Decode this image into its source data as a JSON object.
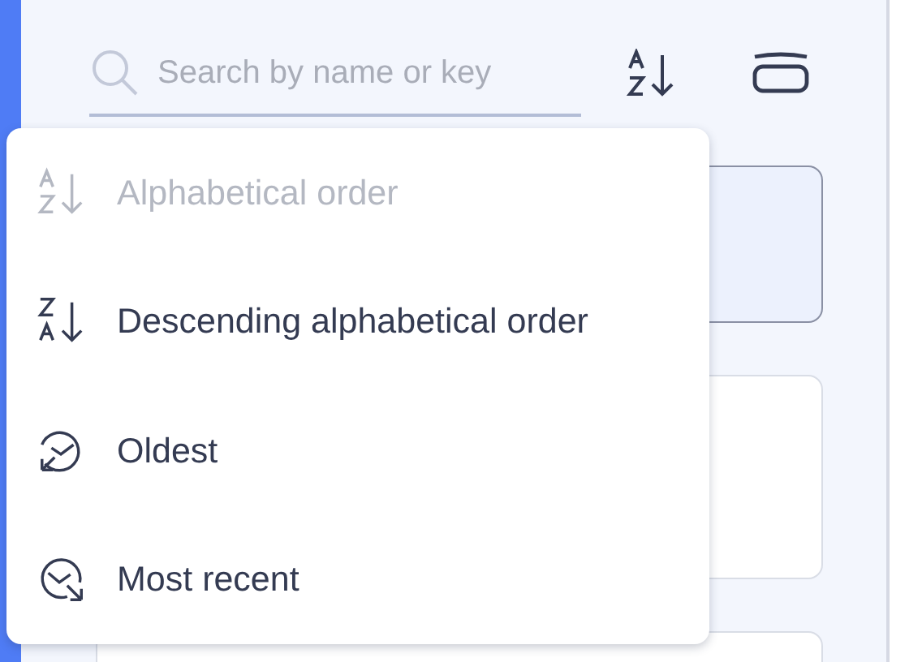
{
  "search": {
    "placeholder": "Search by name or key"
  },
  "cards": [
    {
      "selected": true
    },
    {
      "selected": false
    },
    {
      "selected": false
    }
  ],
  "sort_menu": {
    "items": [
      {
        "label": "Alphabetical order",
        "kind": "az",
        "disabled": true
      },
      {
        "label": "Descending alphabetical order",
        "kind": "za",
        "disabled": false
      },
      {
        "label": "Oldest",
        "kind": "oldest",
        "disabled": false
      },
      {
        "label": "Most recent",
        "kind": "recent",
        "disabled": false
      }
    ]
  }
}
